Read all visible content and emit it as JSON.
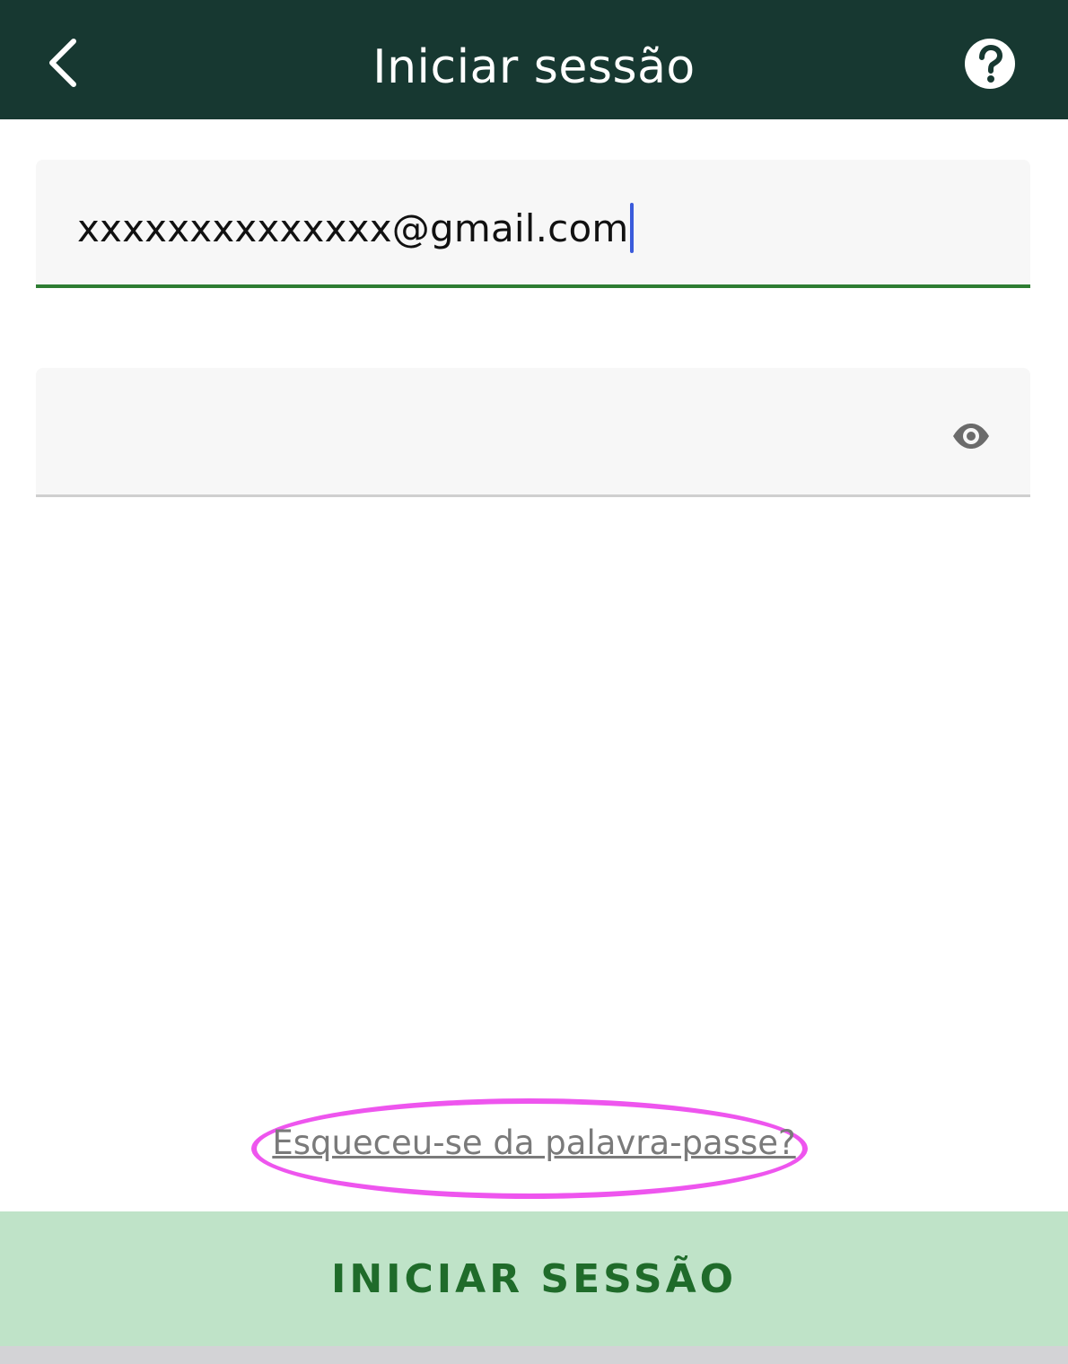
{
  "header": {
    "title": "Iniciar sessão",
    "back_icon": "chevron-left-icon",
    "help_icon": "question-circle-icon",
    "background_color": "#173831"
  },
  "form": {
    "email_value": "xxxxxxxxxxxxxx@gmail.com",
    "password_value": "",
    "password_toggle_icon": "eye-icon",
    "focus_color": "#2e7d32"
  },
  "forgot_password": {
    "label": "Esqueceu-se da palavra-passe?",
    "highlight_color": "#ee55ee"
  },
  "submit": {
    "label": "INICIAR SESSÃO",
    "background_color": "#bfe3c8",
    "text_color": "#1f6b2a"
  }
}
